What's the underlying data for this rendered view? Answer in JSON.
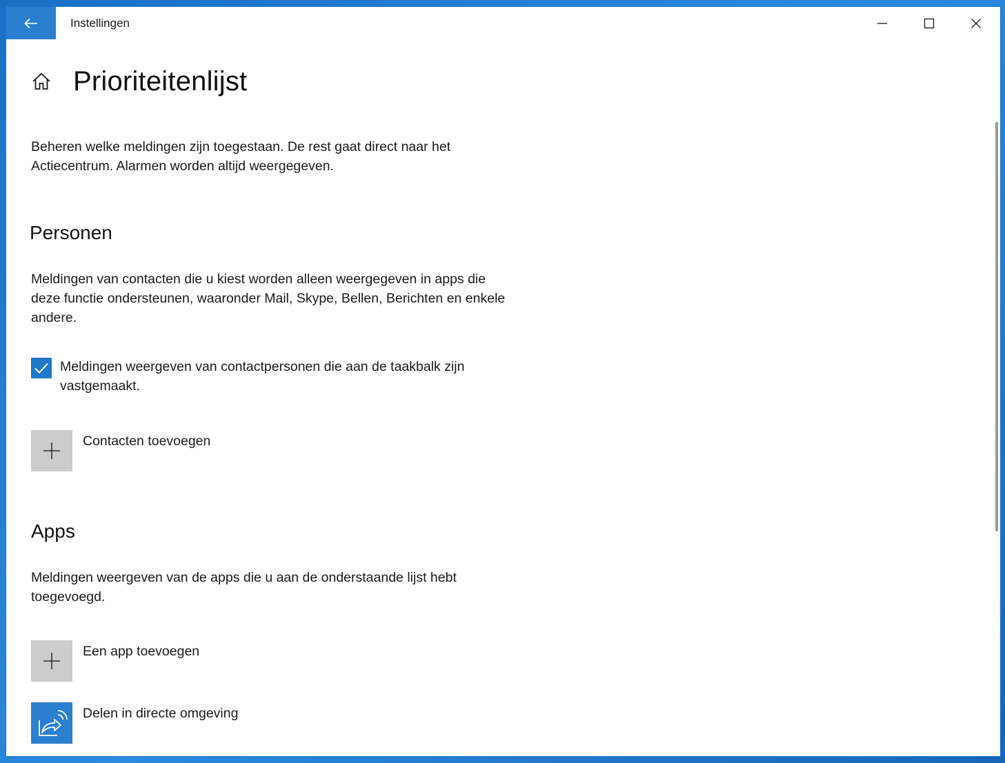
{
  "window": {
    "title": "Instellingen",
    "accent_color": "#2b7fd0"
  },
  "icons": {
    "back": "back-arrow-icon",
    "minimize": "minimize-icon",
    "maximize": "maximize-icon",
    "close": "close-icon",
    "home": "home-icon",
    "checkmark": "checkmark-icon",
    "plus": "plus-icon",
    "share": "nearby-share-icon"
  },
  "page": {
    "title": "Prioriteitenlijst",
    "intro": "Beheren welke meldingen zijn toegestaan. De rest gaat direct naar het Actiecentrum. Alarmen worden altijd weergegeven."
  },
  "personen": {
    "heading": "Personen",
    "description": "Meldingen van contacten die u kiest worden alleen weergegeven in apps die deze functie ondersteunen, waaronder Mail, Skype, Bellen, Berichten en enkele andere.",
    "checkbox_label": "Meldingen weergeven van contactpersonen die aan de taakbalk zijn vastgemaakt.",
    "checkbox_checked": true,
    "add_contacts_label": "Contacten toevoegen"
  },
  "apps": {
    "heading": "Apps",
    "description": "Meldingen weergeven van de apps die u aan de onderstaande lijst hebt toegevoegd.",
    "add_app_label": "Een app toevoegen",
    "items": [
      {
        "label": "Delen in directe omgeving"
      }
    ]
  }
}
